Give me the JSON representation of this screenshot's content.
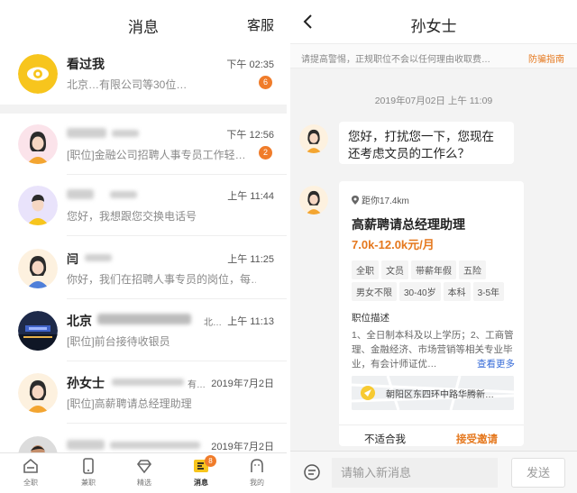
{
  "left": {
    "header": {
      "title": "消息",
      "service": "客服"
    },
    "messages": [
      {
        "name": "看过我",
        "time": "下午 02:35",
        "snippet": "北京…有限公司等30位…",
        "badge": "6"
      },
      {
        "name": "",
        "time": "下午 12:56",
        "snippet": "[职位]金融公司招聘人事专员工作轻…",
        "badge": "2"
      },
      {
        "name": "",
        "time": "上午 11:44",
        "snippet": "您好，我想跟您交换电话号",
        "badge": ""
      },
      {
        "name": "",
        "time": "上午 11:25",
        "snippet": "你好，我们在招聘人事专员的岗位，每…",
        "badge": ""
      },
      {
        "name": "北京",
        "sub": "北…",
        "time": "上午 11:13",
        "snippet": "[职位]前台接待收银员",
        "badge": ""
      },
      {
        "name": "孙女士",
        "sub": "有…",
        "time": "2019年7月2日",
        "snippet": "[职位]高薪聘请总经理助理",
        "badge": ""
      },
      {
        "name": "",
        "time": "2019年7月2日",
        "snippet": "",
        "badge": ""
      }
    ],
    "tabs": [
      {
        "label": "全职",
        "icon": "home-icon"
      },
      {
        "label": "兼职",
        "icon": "phone-icon"
      },
      {
        "label": "精选",
        "icon": "diamond-icon"
      },
      {
        "label": "消息",
        "icon": "message-icon",
        "badge": "8"
      },
      {
        "label": "我的",
        "icon": "profile-icon"
      }
    ]
  },
  "right": {
    "header": {
      "title": "孙女士"
    },
    "warning": {
      "text": "请提高警惕，正规职位不会以任何理由收取费…",
      "link": "防骗指南"
    },
    "date": "2019年07月02日 上午 11:09",
    "bubble": "您好，打扰您一下，您现在还考虑文员的工作么？",
    "card": {
      "distance": "距你17.4km",
      "title": "高薪聘请总经理助理",
      "salary": "7.0k-12.0k元/月",
      "tags_row1": [
        "全职",
        "文员",
        "带薪年假",
        "五险"
      ],
      "tags_row2": [
        "男女不限",
        "30-40岁",
        "本科",
        "3-5年"
      ],
      "section": "职位描述",
      "description": "1、全日制本科及以上学历；2、工商管理、金融经济、市场营销等相关专业毕业，有会计师证优…",
      "more": "查看更多",
      "location": "朝阳区东四环中路华腾新…",
      "decline": "不适合我",
      "accept": "接受邀请"
    },
    "input": {
      "placeholder": "请输入新消息",
      "send": "发送"
    }
  },
  "colors": {
    "accent": "#e5781e",
    "badge": "#f07c2a",
    "eye_yellow": "#f7c51d",
    "link_blue": "#3a6ed8"
  }
}
